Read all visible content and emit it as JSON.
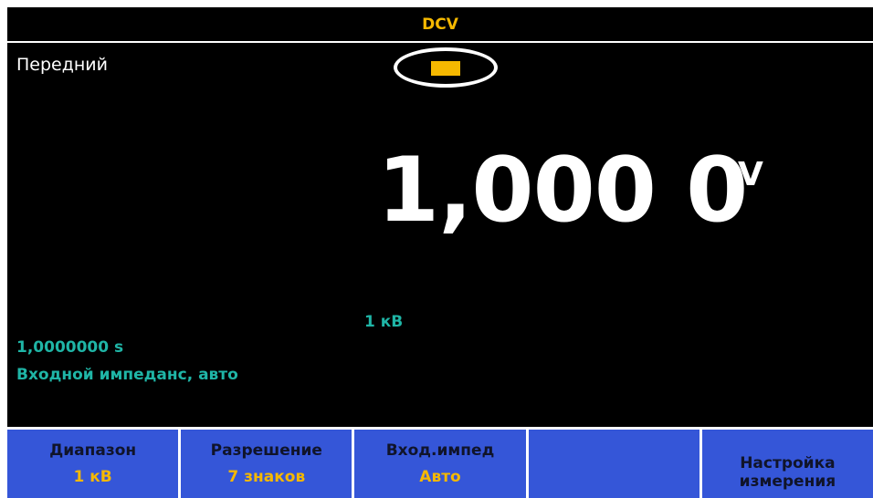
{
  "header": {
    "function": "DCV"
  },
  "status": {
    "terminal": "Передний"
  },
  "display": {
    "reading": "1,000 0",
    "unit": "V",
    "range_annunciator": "1 кВ"
  },
  "info": {
    "aperture": "1,0000000 s",
    "input_impedance": "Входной импеданс, авто"
  },
  "softkeys": [
    {
      "label": "Диапазон",
      "value": "1 кВ"
    },
    {
      "label": "Разрешение",
      "value": "7 знаков"
    },
    {
      "label": "Вход.импед",
      "value": "Авто"
    },
    {
      "label": "",
      "value": ""
    },
    {
      "label_line1": "Настройка",
      "label_line2": "измерения"
    }
  ],
  "colors": {
    "accent": "#f5b800",
    "info_text": "#1fb5a6",
    "softkey_bg": "#3556d8",
    "screen_bg": "#000000"
  }
}
